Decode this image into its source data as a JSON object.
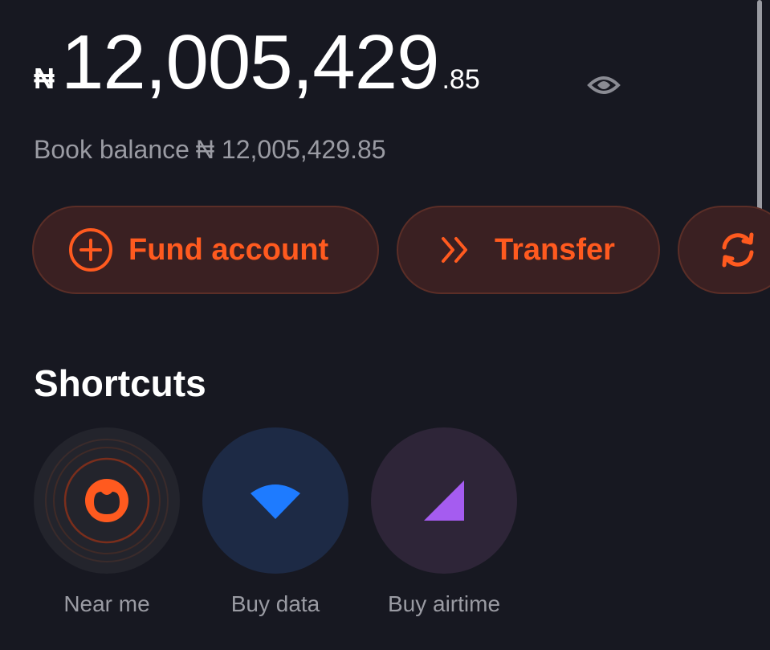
{
  "balance": {
    "currency_symbol": "₦",
    "amount_whole": "12,005,429",
    "amount_decimals": ".85",
    "visibility_icon": "eye-icon"
  },
  "book_balance": {
    "label": "Book balance",
    "value": "₦ 12,005,429.85"
  },
  "actions": [
    {
      "label": "Fund account",
      "icon": "plus-circle-icon"
    },
    {
      "label": "Transfer",
      "icon": "double-chevron-right-icon"
    },
    {
      "label": "",
      "icon": "refresh-icon"
    }
  ],
  "shortcuts": {
    "title": "Shortcuts",
    "items": [
      {
        "label": "Near me",
        "icon": "near-me-icon"
      },
      {
        "label": "Buy data",
        "icon": "wifi-icon"
      },
      {
        "label": "Buy airtime",
        "icon": "signal-icon"
      }
    ]
  },
  "colors": {
    "background": "#171821",
    "accent": "#ff5a1f",
    "button_bg": "#3a2022",
    "muted_text": "#9a9ba3",
    "data_blue": "#1e7bff",
    "airtime_purple": "#a55cf0"
  }
}
